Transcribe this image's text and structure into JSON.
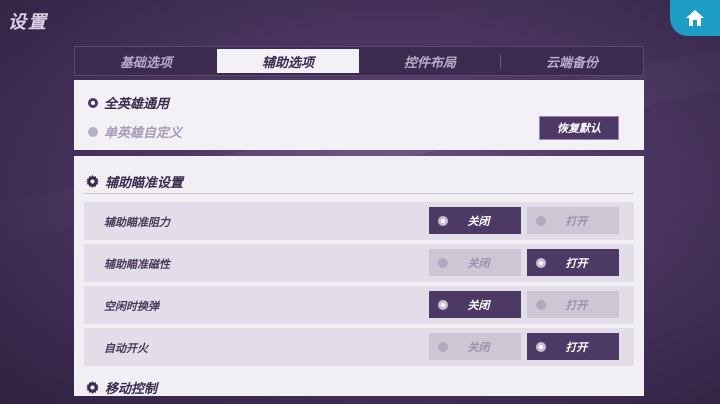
{
  "header": {
    "title": "设置",
    "home_icon": "home-icon"
  },
  "tabs": [
    {
      "label": "基础选项",
      "active": false
    },
    {
      "label": "辅助选项",
      "active": true
    },
    {
      "label": "控件布局",
      "active": false
    },
    {
      "label": "云端备份",
      "active": false
    }
  ],
  "hero_mode": {
    "options": [
      {
        "label": "全英雄通用",
        "selected": true
      },
      {
        "label": "单英雄自定义",
        "selected": false
      }
    ],
    "reset_label": "恢复默认"
  },
  "sections": {
    "aim": {
      "title": "辅助瞄准设置"
    },
    "move": {
      "title": "移动控制"
    }
  },
  "settings": [
    {
      "label": "辅助瞄准阻力",
      "off_label": "关闭",
      "on_label": "打开",
      "value": "off"
    },
    {
      "label": "辅助瞄准磁性",
      "off_label": "关闭",
      "on_label": "打开",
      "value": "on"
    },
    {
      "label": "空闲时换弹",
      "off_label": "关闭",
      "on_label": "打开",
      "value": "off"
    },
    {
      "label": "自动开火",
      "off_label": "关闭",
      "on_label": "打开",
      "value": "on"
    }
  ],
  "colors": {
    "accent": "#4c3966",
    "panel": "#f1eff4",
    "home_button": "#1f9ec5"
  }
}
